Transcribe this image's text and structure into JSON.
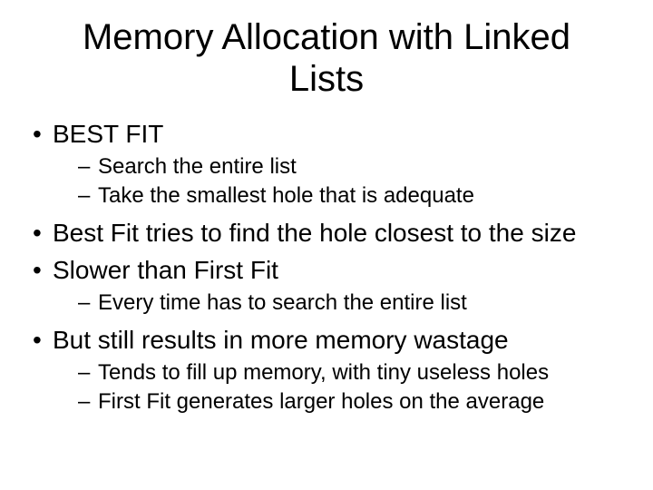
{
  "title": "Memory Allocation with Linked Lists",
  "bullets": [
    {
      "text": "BEST FIT",
      "sub": [
        "Search the entire list",
        "Take the smallest hole that is adequate"
      ]
    },
    {
      "text": "Best Fit tries to find the hole closest to the size",
      "sub": []
    },
    {
      "text": "Slower than First Fit",
      "sub": [
        "Every time has to search the entire list"
      ]
    },
    {
      "text": "But still results in more memory wastage",
      "sub": [
        "Tends to fill up memory, with tiny useless holes",
        "First Fit generates larger holes on the average"
      ]
    }
  ]
}
